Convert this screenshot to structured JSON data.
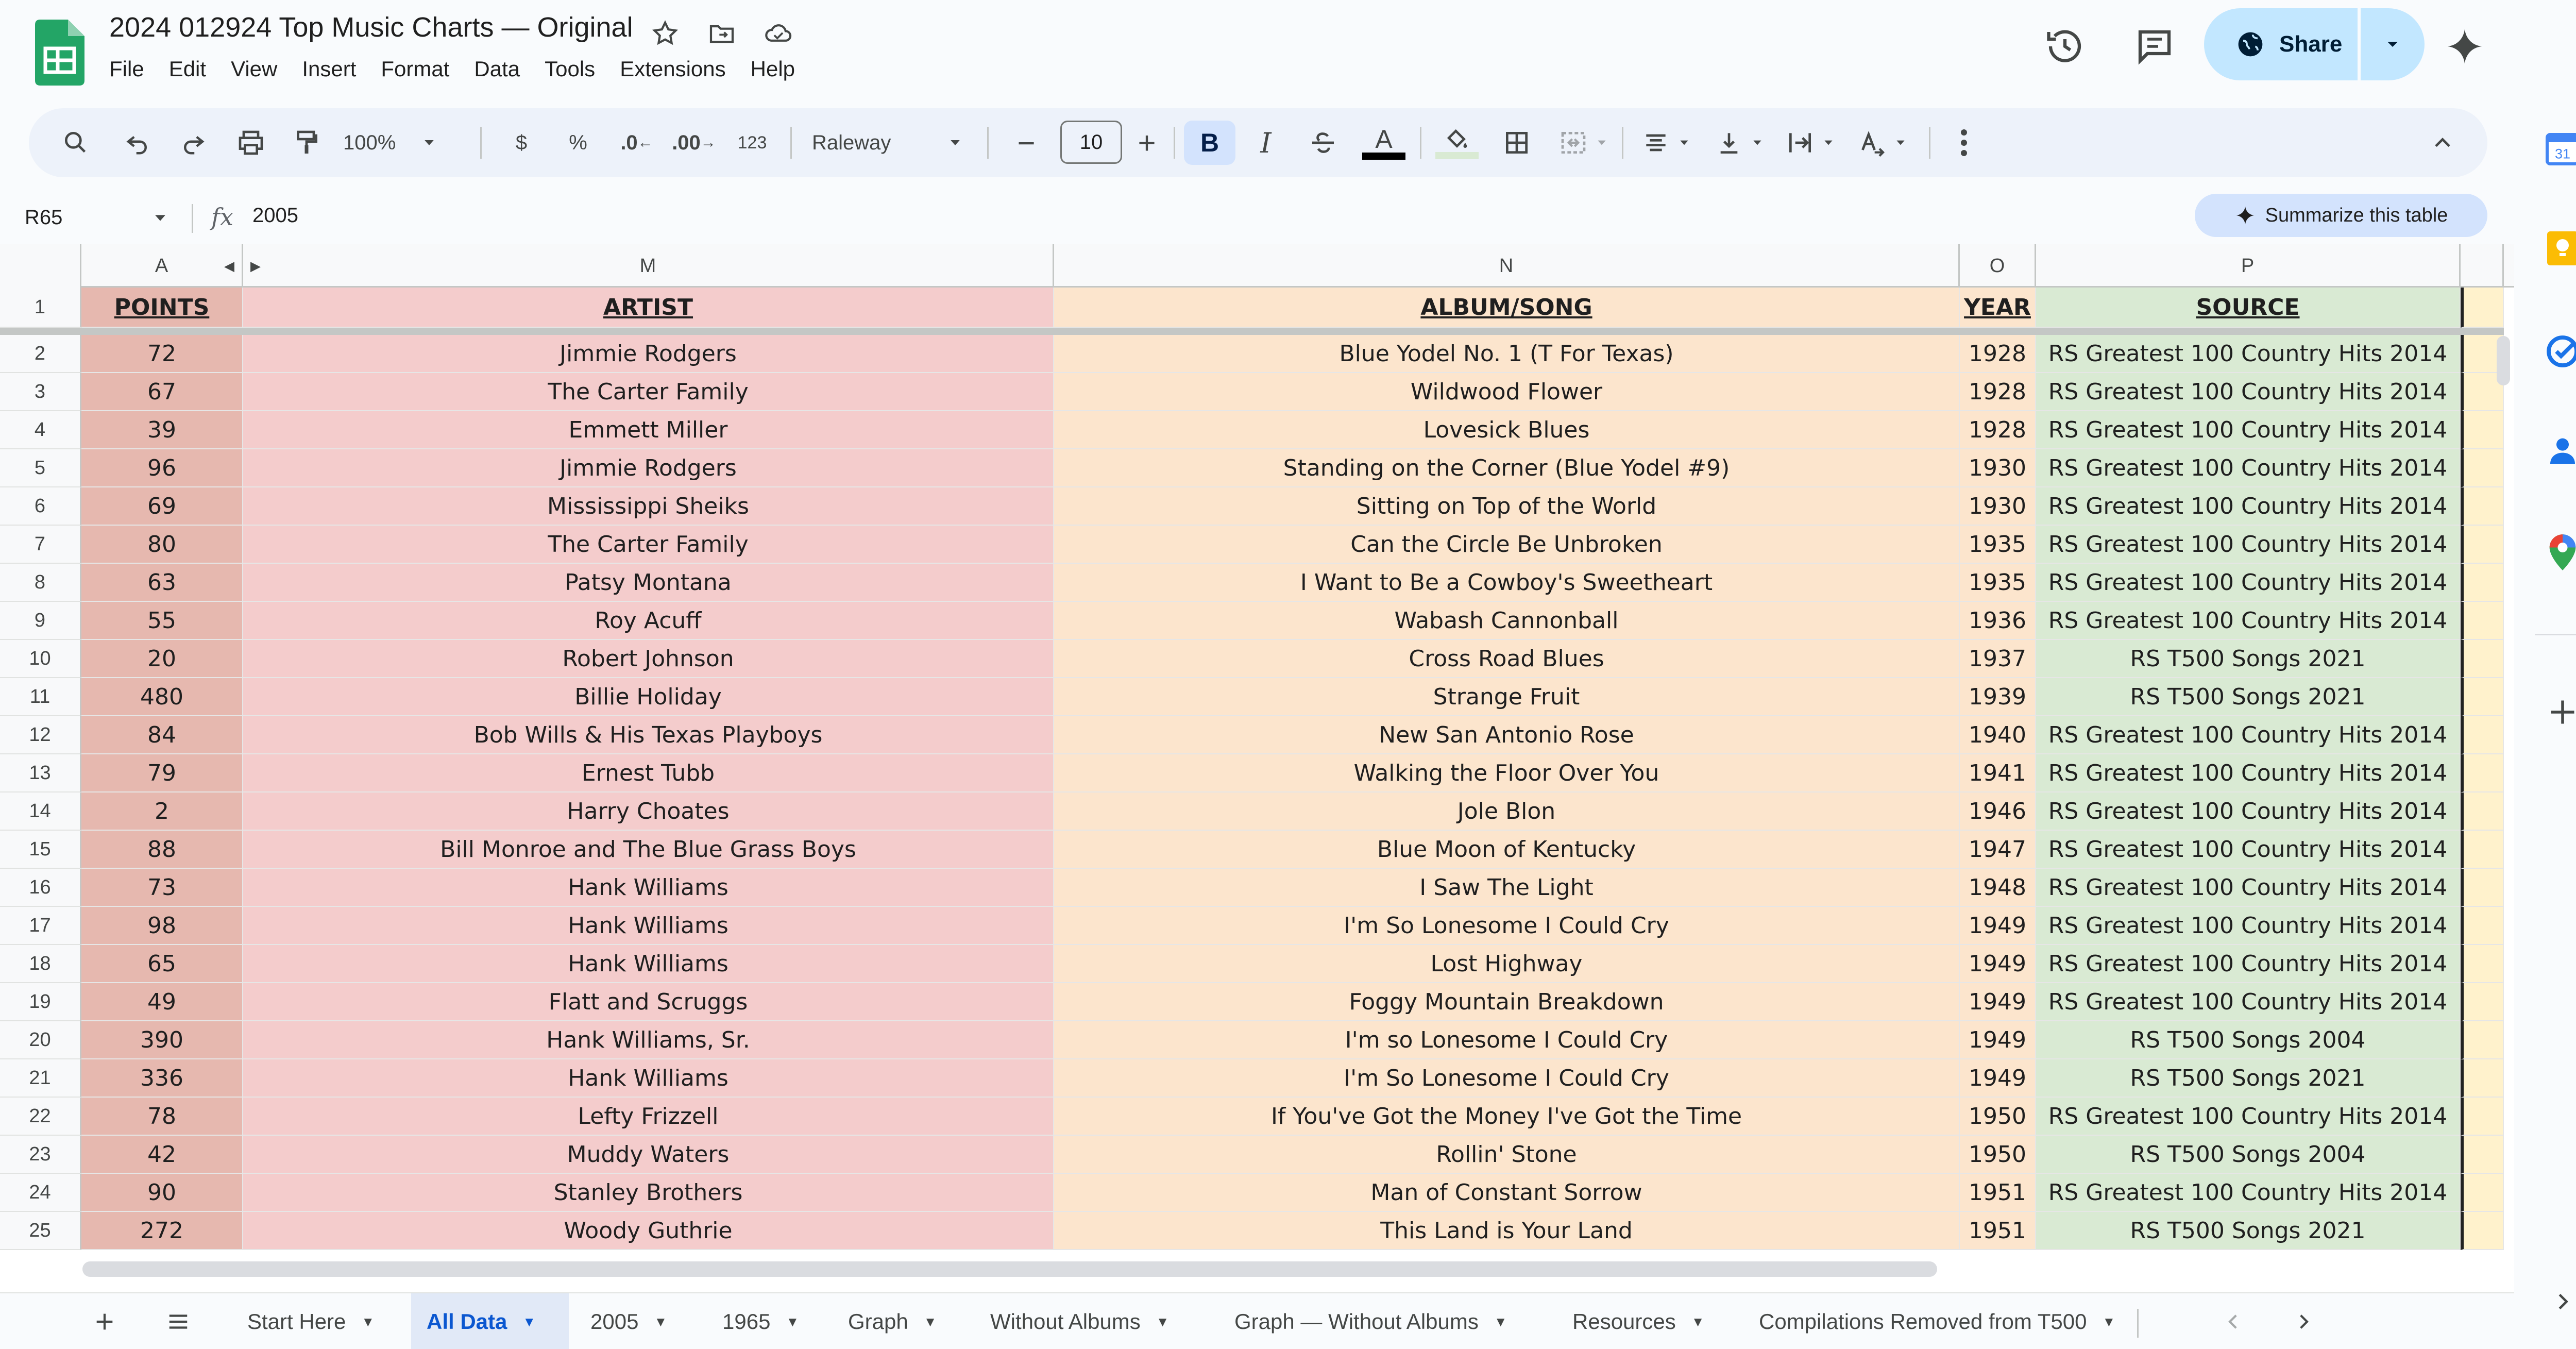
{
  "doc": {
    "title": "2024 012924 Top Music Charts — Original",
    "menu": [
      "File",
      "Edit",
      "View",
      "Insert",
      "Format",
      "Data",
      "Tools",
      "Extensions",
      "Help"
    ],
    "share_label": "Share"
  },
  "toolbar": {
    "zoom": "100%",
    "currency": "$",
    "percent": "%",
    "dec_decrease": ".0",
    "dec_increase": ".00",
    "number_format": "123",
    "font": "Raleway",
    "font_size": "10",
    "bold": "B",
    "italic": "I",
    "text_color": "A"
  },
  "formula": {
    "cell_ref": "R65",
    "fx": "fx",
    "value": "2005",
    "summarize_label": "Summarize this table"
  },
  "columns": [
    "A",
    "M",
    "N",
    "O",
    "P"
  ],
  "header": {
    "points": "POINTS",
    "artist": "ARTIST",
    "album": "ALBUM/SONG",
    "year": "YEAR",
    "source": "SOURCE"
  },
  "rows": [
    {
      "n": "2",
      "points": "72",
      "artist": "Jimmie Rodgers",
      "album": "Blue Yodel No. 1 (T For Texas)",
      "year": "1928",
      "source": "RS Greatest 100 Country Hits 2014"
    },
    {
      "n": "3",
      "points": "67",
      "artist": "The Carter Family",
      "album": "Wildwood Flower",
      "year": "1928",
      "source": "RS Greatest 100 Country Hits 2014"
    },
    {
      "n": "4",
      "points": "39",
      "artist": "Emmett Miller",
      "album": "Lovesick Blues",
      "year": "1928",
      "source": "RS Greatest 100 Country Hits 2014"
    },
    {
      "n": "5",
      "points": "96",
      "artist": "Jimmie Rodgers",
      "album": "Standing on the Corner (Blue Yodel #9)",
      "year": "1930",
      "source": "RS Greatest 100 Country Hits 2014"
    },
    {
      "n": "6",
      "points": "69",
      "artist": "Mississippi Sheiks",
      "album": "Sitting on Top of the World",
      "year": "1930",
      "source": "RS Greatest 100 Country Hits 2014"
    },
    {
      "n": "7",
      "points": "80",
      "artist": "The Carter Family",
      "album": "Can the Circle Be Unbroken",
      "year": "1935",
      "source": "RS Greatest 100 Country Hits 2014"
    },
    {
      "n": "8",
      "points": "63",
      "artist": "Patsy Montana",
      "album": "I Want to Be a Cowboy's Sweetheart",
      "year": "1935",
      "source": "RS Greatest 100 Country Hits 2014"
    },
    {
      "n": "9",
      "points": "55",
      "artist": "Roy Acuff",
      "album": "Wabash Cannonball",
      "year": "1936",
      "source": "RS Greatest 100 Country Hits 2014"
    },
    {
      "n": "10",
      "points": "20",
      "artist": "Robert Johnson",
      "album": "Cross Road Blues",
      "year": "1937",
      "source": "RS T500 Songs 2021"
    },
    {
      "n": "11",
      "points": "480",
      "artist": "Billie Holiday",
      "album": "Strange Fruit",
      "year": "1939",
      "source": "RS T500 Songs 2021"
    },
    {
      "n": "12",
      "points": "84",
      "artist": "Bob Wills & His Texas Playboys",
      "album": "New San Antonio Rose",
      "year": "1940",
      "source": "RS Greatest 100 Country Hits 2014"
    },
    {
      "n": "13",
      "points": "79",
      "artist": "Ernest Tubb",
      "album": "Walking the Floor Over You",
      "year": "1941",
      "source": "RS Greatest 100 Country Hits 2014"
    },
    {
      "n": "14",
      "points": "2",
      "artist": "Harry Choates",
      "album": "Jole Blon",
      "year": "1946",
      "source": "RS Greatest 100 Country Hits 2014"
    },
    {
      "n": "15",
      "points": "88",
      "artist": "Bill Monroe and The Blue Grass Boys",
      "album": "Blue Moon of Kentucky",
      "year": "1947",
      "source": "RS Greatest 100 Country Hits 2014"
    },
    {
      "n": "16",
      "points": "73",
      "artist": "Hank Williams",
      "album": "I Saw The Light",
      "year": "1948",
      "source": "RS Greatest 100 Country Hits 2014"
    },
    {
      "n": "17",
      "points": "98",
      "artist": "Hank Williams",
      "album": "I'm So Lonesome I Could Cry",
      "year": "1949",
      "source": "RS Greatest 100 Country Hits 2014"
    },
    {
      "n": "18",
      "points": "65",
      "artist": "Hank Williams",
      "album": "Lost Highway",
      "year": "1949",
      "source": "RS Greatest 100 Country Hits 2014"
    },
    {
      "n": "19",
      "points": "49",
      "artist": "Flatt and Scruggs",
      "album": "Foggy Mountain Breakdown",
      "year": "1949",
      "source": "RS Greatest 100 Country Hits 2014"
    },
    {
      "n": "20",
      "points": "390",
      "artist": "Hank Williams, Sr.",
      "album": "I'm so Lonesome I Could Cry",
      "year": "1949",
      "source": "RS T500 Songs 2004"
    },
    {
      "n": "21",
      "points": "336",
      "artist": "Hank Williams",
      "album": "I'm So Lonesome I Could Cry",
      "year": "1949",
      "source": "RS T500 Songs 2021"
    },
    {
      "n": "22",
      "points": "78",
      "artist": "Lefty Frizzell",
      "album": "If You've Got the Money I've Got the Time",
      "year": "1950",
      "source": "RS Greatest 100 Country Hits 2014"
    },
    {
      "n": "23",
      "points": "42",
      "artist": "Muddy Waters",
      "album": "Rollin' Stone",
      "year": "1950",
      "source": "RS T500 Songs 2004"
    },
    {
      "n": "24",
      "points": "90",
      "artist": "Stanley Brothers",
      "album": "Man of Constant Sorrow",
      "year": "1951",
      "source": "RS Greatest 100 Country Hits 2014"
    },
    {
      "n": "25",
      "points": "272",
      "artist": "Woody Guthrie",
      "album": "This Land is Your Land",
      "year": "1951",
      "source": "RS T500 Songs 2021"
    }
  ],
  "tabs": [
    "Start Here",
    "All Data",
    "2005",
    "1965",
    "Graph",
    "Without Albums",
    "Graph — Without Albums",
    "Resources",
    "Compilations Removed from T500"
  ],
  "active_tab": "All Data",
  "icons": {
    "star": "star-icon",
    "folder": "move-folder-icon",
    "cloud": "cloud-saved-icon",
    "history": "history-icon",
    "comment": "comment-icon",
    "gemini": "gemini-sparkle-icon"
  },
  "colors": {
    "points_bg": "#e6b8af",
    "artist_bg": "#f4cccc",
    "album_bg": "#fce5cd",
    "source_bg": "#d9ead3",
    "accent": "#0b57d0",
    "share_bg": "#c2e7ff"
  }
}
